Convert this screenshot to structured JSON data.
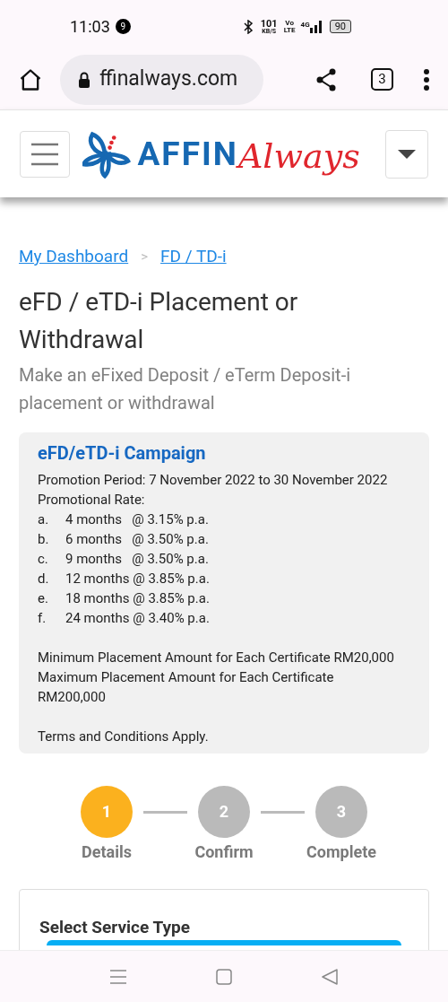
{
  "status_bar": {
    "time": "11:03",
    "notification_count": "9",
    "speed": "101",
    "speed_unit": "KB/S",
    "volte_top": "Vo",
    "volte_bottom": "LTE",
    "network": "4G",
    "battery": "90"
  },
  "browser": {
    "url": "ffinalways.com",
    "tab_count": "3"
  },
  "header": {
    "brand": "AFFIN",
    "brand_script": "Always"
  },
  "breadcrumb": [
    {
      "label": "My Dashboard"
    },
    {
      "label": "FD / TD-i"
    }
  ],
  "breadcrumb_separator": ">",
  "page": {
    "title": "eFD / eTD-i Placement or Withdrawal",
    "subtitle": "Make an eFixed Deposit / eTerm Deposit-i placement or withdrawal"
  },
  "campaign": {
    "title": "eFD/eTD-i Campaign",
    "period": "Promotion Period: 7 November 2022 to 30 November 2022",
    "rate_heading": "Promotional Rate:",
    "rates": [
      {
        "letter": "a.",
        "text": "4 months   @ 3.15% p.a."
      },
      {
        "letter": "b.",
        "text": "6 months   @ 3.50% p.a."
      },
      {
        "letter": "c.",
        "text": "9 months   @ 3.50% p.a."
      },
      {
        "letter": "d.",
        "text": "12 months @ 3.85% p.a."
      },
      {
        "letter": "e.",
        "text": "18 months @ 3.85% p.a."
      },
      {
        "letter": "f.",
        "text": "24 months @ 3.40% p.a."
      }
    ],
    "minimum": "Minimum Placement Amount for Each Certificate RM20,000",
    "maximum": "Maximum Placement Amount for Each Certificate RM200,000",
    "terms": "Terms and Conditions Apply."
  },
  "steps": [
    {
      "number": "1",
      "label": "Details",
      "selected": true
    },
    {
      "number": "2",
      "label": "Confirm",
      "selected": false
    },
    {
      "number": "3",
      "label": "Complete",
      "selected": false
    }
  ],
  "form": {
    "section_title": "Select Service Type"
  }
}
